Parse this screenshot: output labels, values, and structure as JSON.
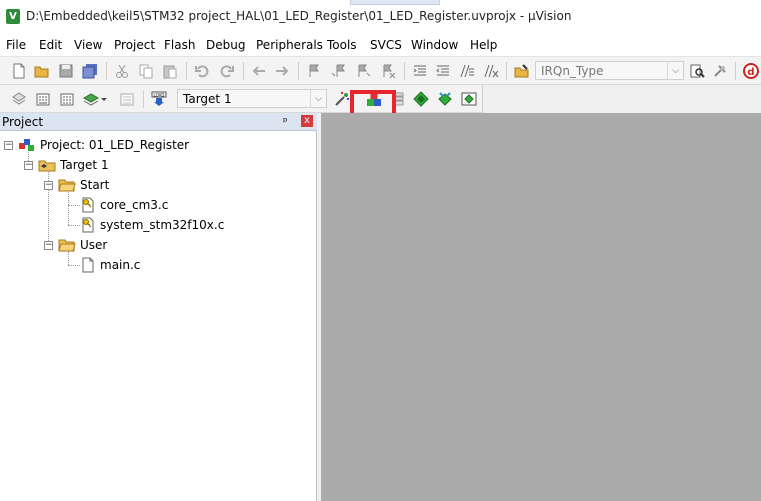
{
  "window": {
    "title": "D:\\Embedded\\keil5\\STM32 project_HAL\\01_LED_Register\\01_LED_Register.uvprojx - µVision",
    "app_icon_letter": "V"
  },
  "menu": [
    "File",
    "Edit",
    "View",
    "Project",
    "Flash",
    "Debug",
    "Peripherals",
    "Tools",
    "SVCS",
    "Window",
    "Help"
  ],
  "toolbar1": {
    "find_combo_value": "IRQn_Type"
  },
  "toolbar2": {
    "target_combo_value": "Target 1"
  },
  "project_panel": {
    "title": "Project",
    "pin_glyph": "ᵖ",
    "close_glyph": "x",
    "tree": {
      "project": "Project: 01_LED_Register",
      "target": "Target 1",
      "group_start": "Start",
      "file_core": "core_cm3.c",
      "file_system": "system_stm32f10x.c",
      "group_user": "User",
      "file_main": "main.c"
    }
  },
  "colors": {
    "highlight_box": "#e8252e",
    "editor_background": "#ababab",
    "panel_header": "#dbe4f1"
  }
}
